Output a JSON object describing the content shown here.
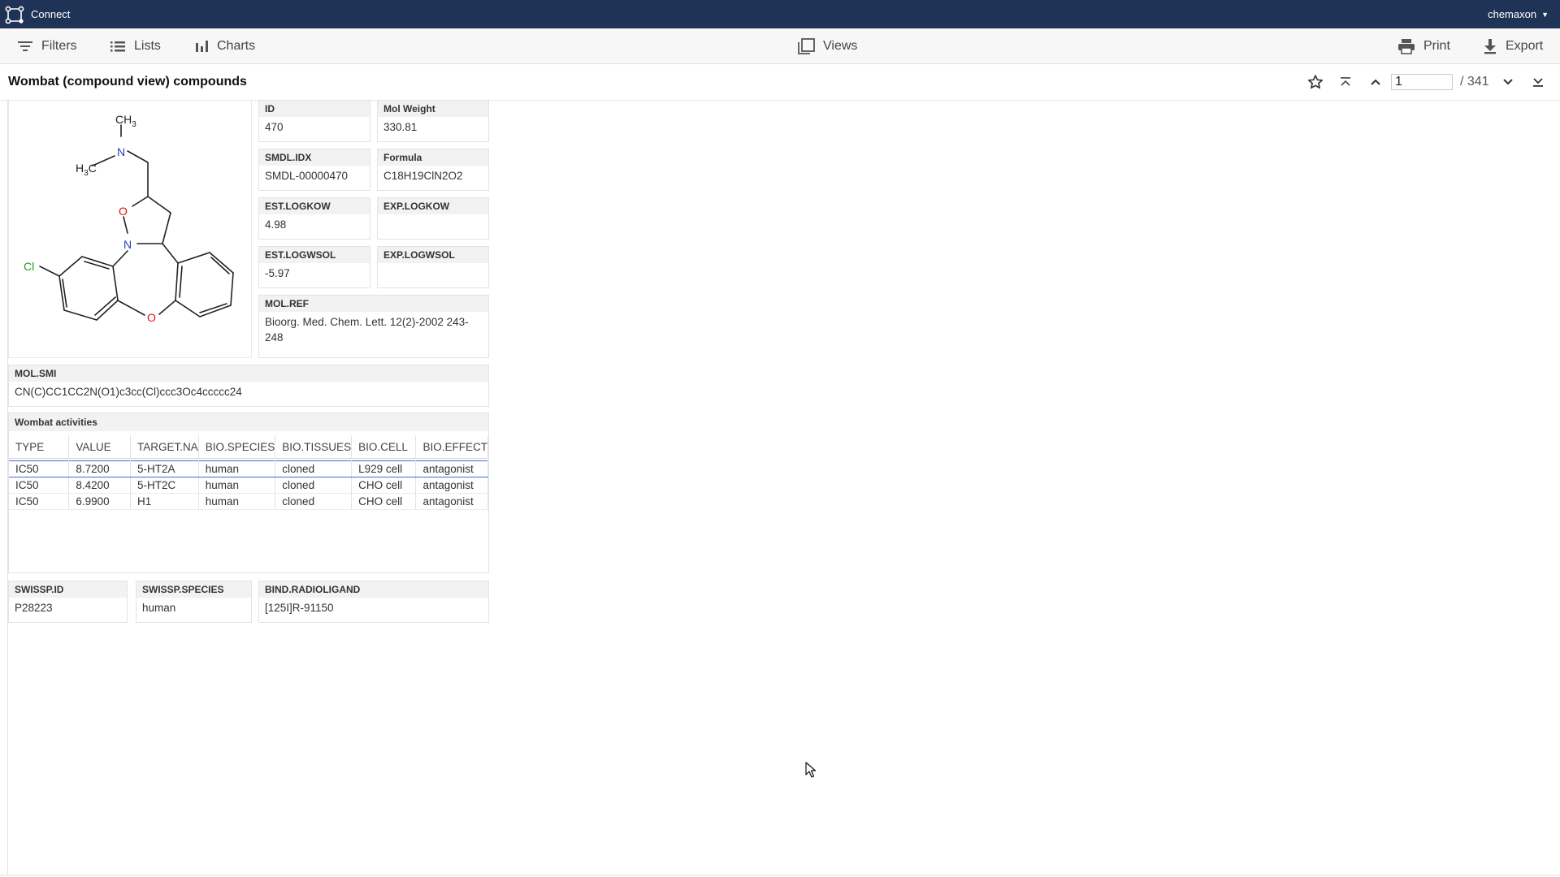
{
  "app": {
    "name": "Connect",
    "user": "chemaxon"
  },
  "toolbar": {
    "filters": "Filters",
    "lists": "Lists",
    "charts": "Charts",
    "views": "Views",
    "print": "Print",
    "export": "Export"
  },
  "view": {
    "title": "Wombat (compound view) compounds",
    "page_current": "1",
    "page_total": "/ 341"
  },
  "structure": {
    "atoms": [
      "CH3",
      "N",
      "H3C",
      "O",
      "N",
      "Cl",
      "O"
    ],
    "colors": {
      "oxygen": "#e01010",
      "nitrogen": "#2b3fbd",
      "chlorine": "#1ea01e"
    }
  },
  "fields": {
    "id": {
      "label": "ID",
      "value": "470"
    },
    "mol_weight": {
      "label": "Mol Weight",
      "value": "330.81"
    },
    "smdl_idx": {
      "label": "SMDL.IDX",
      "value": "SMDL-00000470"
    },
    "formula": {
      "label": "Formula",
      "value": "C18H19ClN2O2"
    },
    "est_logkow": {
      "label": "EST.LOGKOW",
      "value": "4.98"
    },
    "exp_logkow": {
      "label": "EXP.LOGKOW",
      "value": ""
    },
    "est_logwsol": {
      "label": "EST.LOGWSOL",
      "value": "-5.97"
    },
    "exp_logwsol": {
      "label": "EXP.LOGWSOL",
      "value": ""
    },
    "mol_ref": {
      "label": "MOL.REF",
      "value": "Bioorg. Med. Chem. Lett. 12(2)-2002 243-248"
    },
    "mol_smi": {
      "label": "MOL.SMI",
      "value": "CN(C)CC1CC2N(O1)c3cc(Cl)ccc3Oc4ccccc24"
    },
    "swissp_id": {
      "label": "SWISSP.ID",
      "value": "P28223"
    },
    "swissp_species": {
      "label": "SWISSP.SPECIES",
      "value": "human"
    },
    "bind_radioligand": {
      "label": "BIND.RADIOLIGAND",
      "value": "[125I]R-91150"
    }
  },
  "activities": {
    "label": "Wombat activities",
    "columns": [
      "TYPE",
      "VALUE",
      "TARGET.NA",
      "BIO.SPECIES",
      "BIO.TISSUES",
      "BIO.CELL",
      "BIO.EFFECT"
    ],
    "rows": [
      [
        "IC50",
        "8.7200",
        "5-HT2A",
        "human",
        "cloned",
        "L929 cell",
        "antagonist"
      ],
      [
        "IC50",
        "8.4200",
        "5-HT2C",
        "human",
        "cloned",
        "CHO cell",
        "antagonist"
      ],
      [
        "IC50",
        "6.9900",
        "H1",
        "human",
        "cloned",
        "CHO cell",
        "antagonist"
      ]
    ]
  },
  "colors": {
    "topbar": "#1f3356",
    "selection": "#3c6fd1"
  }
}
